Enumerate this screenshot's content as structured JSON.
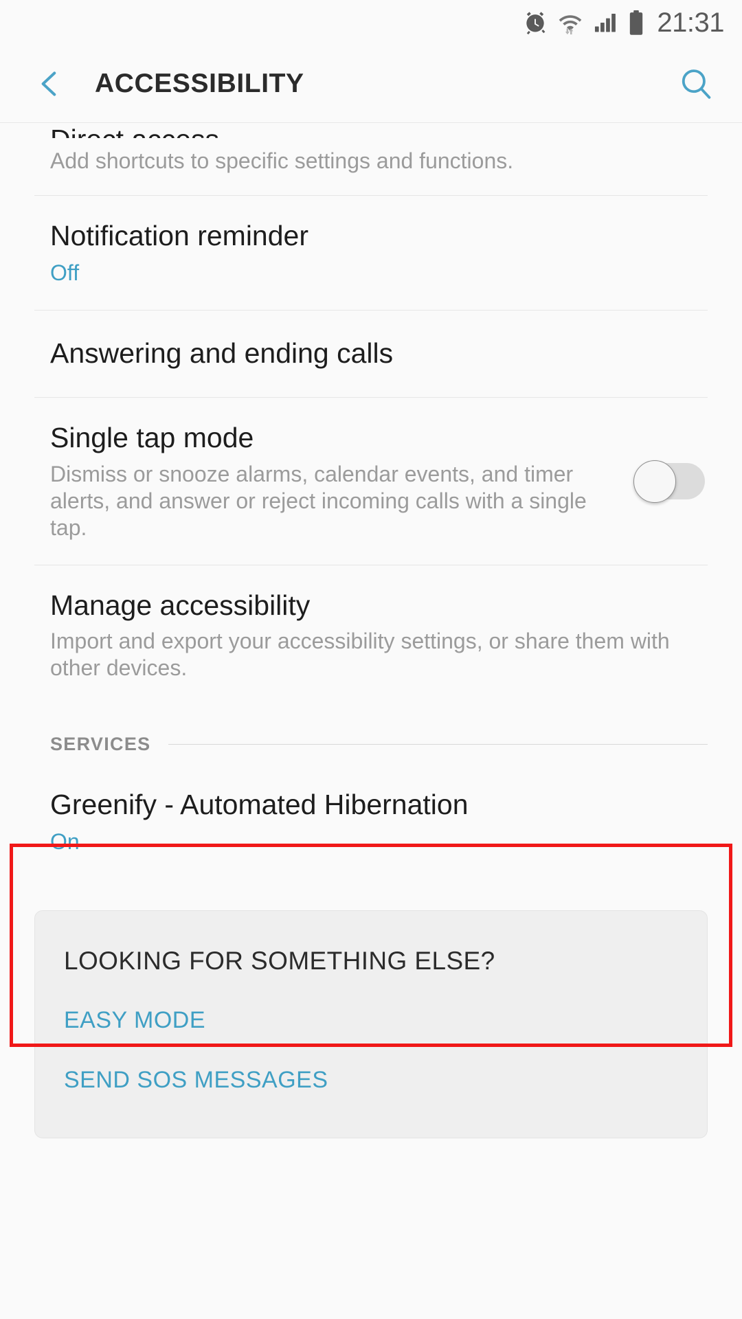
{
  "status_bar": {
    "time": "21:31",
    "icons": [
      "alarm-clock-icon",
      "wifi-icon",
      "cellular-signal-icon",
      "battery-icon"
    ]
  },
  "app_bar": {
    "back_label": "Back",
    "title": "ACCESSIBILITY",
    "search_label": "Search"
  },
  "settings": [
    {
      "title": "Direct access",
      "desc": "Add shortcuts to specific settings and functions.",
      "clipped": true
    },
    {
      "title": "Notification reminder",
      "status": "Off"
    },
    {
      "title": "Answering and ending calls"
    },
    {
      "title": "Single tap mode",
      "desc": "Dismiss or snooze alarms, calendar events, and timer alerts, and answer or reject incoming calls with a single tap.",
      "toggle": "off"
    },
    {
      "title": "Manage accessibility",
      "desc": "Import and export your accessibility settings, or share them with other devices."
    }
  ],
  "services_section": {
    "label": "SERVICES",
    "items": [
      {
        "title": "Greenify - Automated Hibernation",
        "status": "On"
      }
    ]
  },
  "footer_card": {
    "title": "LOOKING FOR SOMETHING ELSE?",
    "links": [
      "EASY MODE",
      "SEND SOS MESSAGES"
    ]
  },
  "colors": {
    "accent": "#3f9fc4",
    "annotation": "#f01818",
    "background": "#fafafa",
    "card": "#efefef",
    "title_text": "#1d1d1d",
    "secondary_text": "#9b9b9b"
  }
}
